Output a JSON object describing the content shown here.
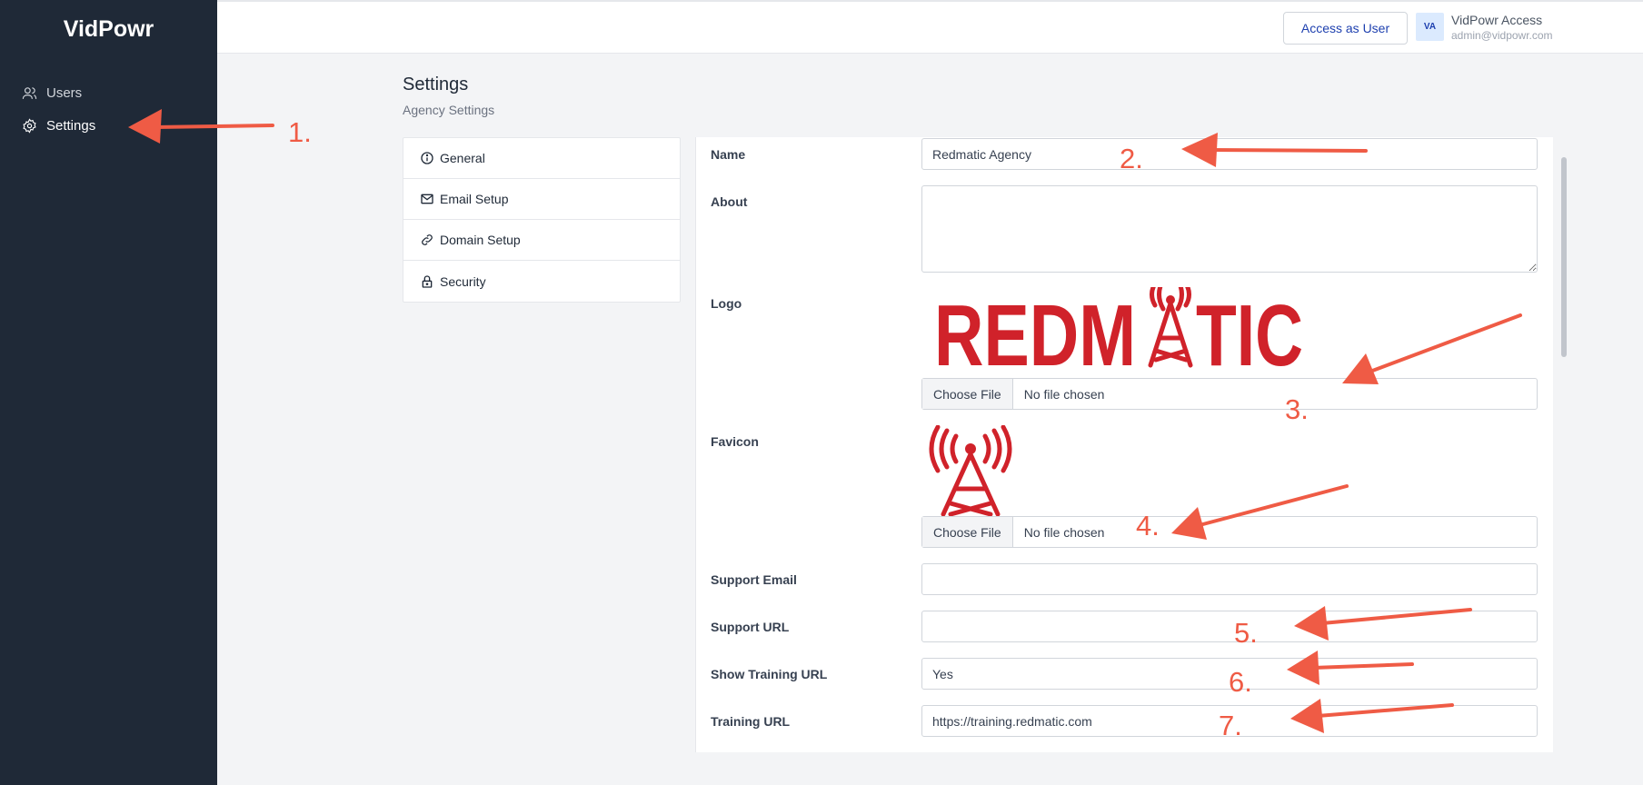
{
  "app": {
    "brand": "VidPowr"
  },
  "sidebar": {
    "items": [
      {
        "label": "Users",
        "icon": "users-icon"
      },
      {
        "label": "Settings",
        "icon": "gear-icon"
      }
    ]
  },
  "header": {
    "access_button": "Access as User",
    "user": {
      "initials": "VA",
      "name": "VidPowr Access",
      "email": "admin@vidpowr.com"
    }
  },
  "page": {
    "title": "Settings",
    "subtitle": "Agency Settings"
  },
  "settings_menu": [
    {
      "label": "General",
      "icon": "info-icon"
    },
    {
      "label": "Email Setup",
      "icon": "mail-icon"
    },
    {
      "label": "Domain Setup",
      "icon": "link-icon"
    },
    {
      "label": "Security",
      "icon": "lock-icon"
    }
  ],
  "form": {
    "name": {
      "label": "Name",
      "value": "Redmatic Agency"
    },
    "about": {
      "label": "About",
      "value": ""
    },
    "logo": {
      "label": "Logo",
      "button": "Choose File",
      "status": "No file chosen",
      "image_text": "REDMATIC"
    },
    "favicon": {
      "label": "Favicon",
      "button": "Choose File",
      "status": "No file chosen"
    },
    "support_email": {
      "label": "Support Email",
      "value": ""
    },
    "support_url": {
      "label": "Support URL",
      "value": ""
    },
    "show_training_url": {
      "label": "Show Training URL",
      "value": "Yes"
    },
    "training_url": {
      "label": "Training URL",
      "value": "https://training.redmatic.com"
    }
  },
  "annotations": [
    "1.",
    "2.",
    "3.",
    "4.",
    "5.",
    "6.",
    "7."
  ],
  "colors": {
    "sidebar_bg": "#1f2937",
    "annotation": "#ef5b45",
    "logo_red": "#d0222a",
    "link_blue": "#1e40af"
  }
}
